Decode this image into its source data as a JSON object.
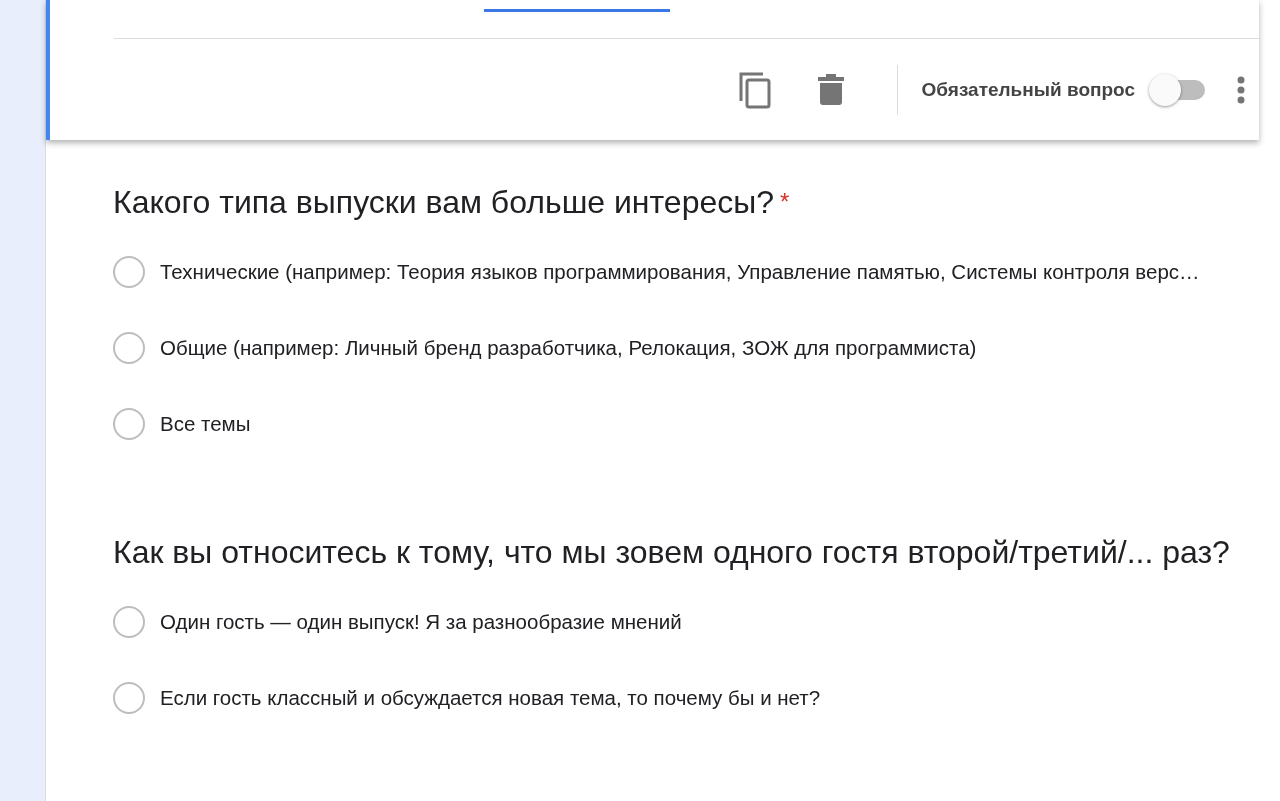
{
  "editor_card": {
    "tab_indicator": true,
    "toolbar": {
      "required_label": "Обязательный вопрос",
      "required_on": false
    }
  },
  "questions": [
    {
      "title": "Какого типа выпуски вам больше интересы?",
      "required_mark": "*",
      "options": [
        {
          "label": "Технические (например: Теория языков программирования, Управление памятью, Системы контроля верс…",
          "selected": false
        },
        {
          "label": "Общие (например: Личный бренд разработчика, Релокация, ЗОЖ для программиста)",
          "selected": false
        },
        {
          "label": "Все темы",
          "selected": false
        }
      ]
    },
    {
      "title": "Как вы относитесь к тому, что мы зовем одного гостя второй/третий/... раз?",
      "options": [
        {
          "label": "Один гость — один выпуск! Я за разнообразие мнений",
          "selected": false
        },
        {
          "label": "Если гость классный и обсуждается новая тема, то почему бы и нет?",
          "selected": false
        }
      ]
    }
  ]
}
